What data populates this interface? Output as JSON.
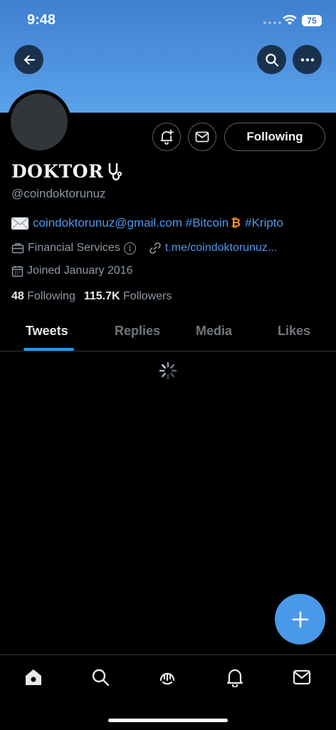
{
  "status_bar": {
    "time": "9:48",
    "battery": "75"
  },
  "profile": {
    "display_name": "DOKTOR",
    "handle": "@coindoktorunuz",
    "bio": {
      "email": "coindoktorunuz@gmail.com",
      "hashtag_bitcoin": "#Bitcoin",
      "hashtag_kripto": "#Kripto"
    },
    "category": "Financial Services",
    "website": "t.me/coindoktorunuz...",
    "joined": "Joined January 2016",
    "following_count": "48",
    "following_label": "Following",
    "followers_count": "115.7K",
    "followers_label": "Followers",
    "follow_button_label": "Following"
  },
  "tabs": [
    {
      "label": "Tweets",
      "active": true
    },
    {
      "label": "Replies",
      "active": false
    },
    {
      "label": "Media",
      "active": false
    },
    {
      "label": "Likes",
      "active": false
    }
  ],
  "colors": {
    "banner": "#4a90e0",
    "accent": "#1d9bf0",
    "link": "#4a99e9",
    "bitcoin": "#f7931a"
  },
  "icons": {
    "header": [
      "back-arrow-icon",
      "search-icon",
      "more-icon"
    ],
    "nav": [
      "home-icon",
      "search-icon",
      "spaces-icon",
      "notifications-icon",
      "messages-icon"
    ],
    "fab": "plus-icon"
  }
}
